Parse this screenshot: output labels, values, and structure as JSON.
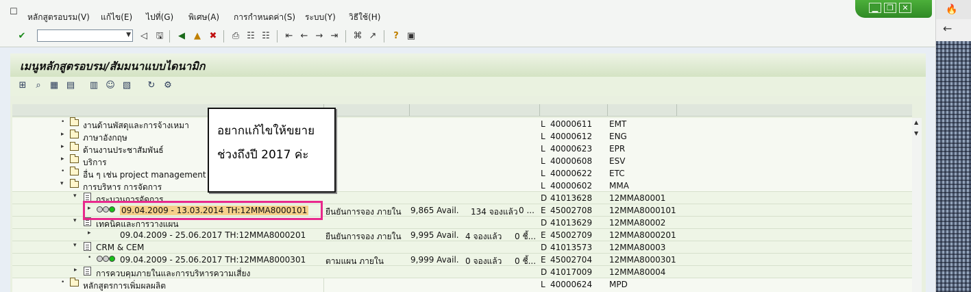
{
  "menu": [
    "หลักสูตรอบรม(V)",
    "แก้ไข(E)",
    "ไปที่(G)",
    "พิเศษ(A)",
    "การกำหนดค่า(S)",
    "ระบบ(Y)",
    "วิธีใช้(H)"
  ],
  "title": "เมนูหลักสูตรอบรม/สัมมนาแบบไดนามิก",
  "rows": [
    {
      "id": "r1",
      "name": "งานด้านพัสดุและการจ้างเหมา",
      "type": "L",
      "code": "40000611",
      "abbr": "EMT"
    },
    {
      "id": "r2",
      "name": "ภาษาอังกฤษ",
      "type": "L",
      "code": "40000612",
      "abbr": "ENG"
    },
    {
      "id": "r3",
      "name": "ด้านงานประชาสัมพันธ์",
      "type": "L",
      "code": "40000623",
      "abbr": "EPR"
    },
    {
      "id": "r4",
      "name": "บริการ",
      "type": "L",
      "code": "40000608",
      "abbr": "ESV"
    },
    {
      "id": "r5",
      "name": "อื่น ๆ เช่น project management",
      "type": "L",
      "code": "40000622",
      "abbr": "ETC"
    },
    {
      "id": "r6",
      "name": "การบริหาร การจัดการ",
      "type": "L",
      "code": "40000602",
      "abbr": "MMA"
    },
    {
      "id": "r7",
      "name": "กระบวนการจัดการ",
      "type": "D",
      "code": "41013628",
      "abbr": "12MMA80001"
    },
    {
      "id": "r8",
      "name": "09.04.2009 - 13.03.2014 TH:12MMA8000101",
      "status": "ยืนยันการจอง ภายใน",
      "avail": "9,865 Avail.",
      "booked": "134 จองแล้ว",
      "extra": "0 ...",
      "type": "E",
      "code": "45002708",
      "abbr": "12MMA8000101"
    },
    {
      "id": "r9",
      "name": "เทคนิคและการวางแผน",
      "type": "D",
      "code": "41013629",
      "abbr": "12MMA80002"
    },
    {
      "id": "r10",
      "name": "09.04.2009 - 25.06.2017 TH:12MMA8000201",
      "status": "ยืนยันการจอง ภายใน",
      "avail": "9,995 Avail.",
      "booked": "4 จองแล้ว",
      "extra": "0 ชี้...",
      "type": "E",
      "code": "45002709",
      "abbr": "12MMA8000201"
    },
    {
      "id": "r11",
      "name": "CRM & CEM",
      "type": "D",
      "code": "41013573",
      "abbr": "12MMA80003"
    },
    {
      "id": "r12",
      "name": "09.04.2009 - 25.06.2017 TH:12MMA8000301",
      "status": "ตามแผน ภายใน",
      "avail": "9,999 Avail.",
      "booked": "0 จองแล้ว",
      "extra": "0 ชี้...",
      "type": "E",
      "code": "45002704",
      "abbr": "12MMA8000301"
    },
    {
      "id": "r13",
      "name": "การควบคุมภายในและการบริหารความเสี่ยง",
      "type": "D",
      "code": "41017009",
      "abbr": "12MMA80004"
    },
    {
      "id": "r14",
      "name": "หลักสูตรการเพิ่มผลผลิต",
      "type": "L",
      "code": "40000624",
      "abbr": "MPD"
    }
  ],
  "annotation": {
    "line1": "อยากแก้ไขให้ขยาย",
    "line2": "ช่วงถึงปี 2017 ค่ะ"
  },
  "icons": {
    "menu": "menu-entry-icon",
    "enter": "enter-check-icon",
    "save": "save-icon",
    "back": "back-icon",
    "exit": "exit-icon",
    "cancel": "cancel-icon",
    "print": "print-icon",
    "find": "find-icon",
    "find_next": "find-next-icon",
    "first_page": "first-page-icon",
    "prev_page": "prev-page-icon",
    "next_page": "next-page-icon",
    "last_page": "last-page-icon",
    "layout": "layout-icon",
    "shortcut": "shortcut-icon",
    "help": "help-icon",
    "customize": "customize-icon"
  },
  "colors": {
    "bg": "#e8eef5",
    "title_bg": "#d4e3c4",
    "highlight": "#f5d08a",
    "annotation_border": "#e8288c",
    "window_control": "#2f8a25"
  }
}
